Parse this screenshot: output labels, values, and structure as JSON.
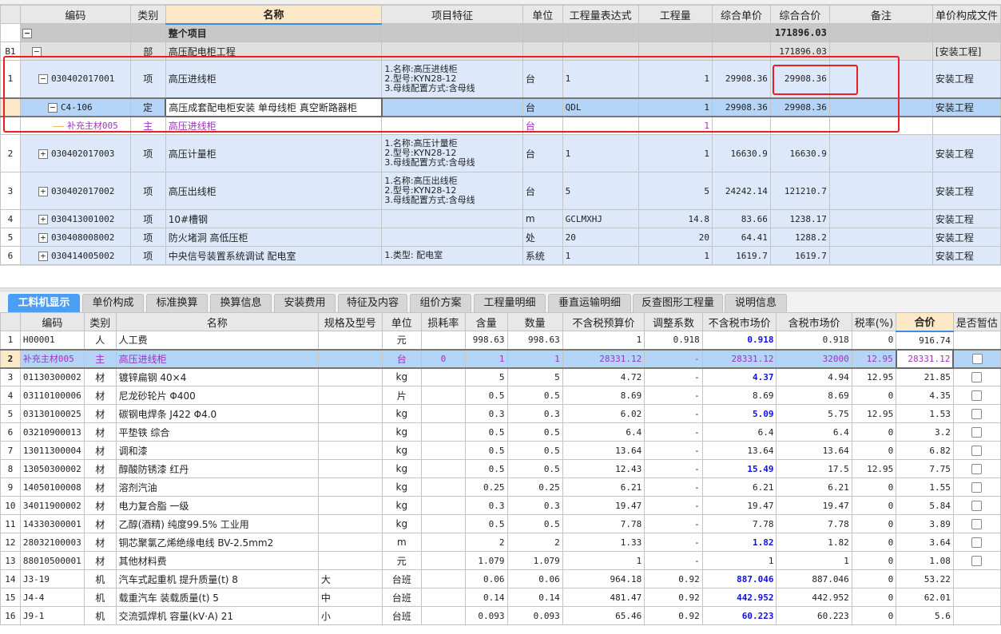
{
  "accent_color": "#4a9ff5",
  "highlight_color": "#e82020",
  "top_table": {
    "headers": [
      "",
      "编码",
      "类别",
      "名称",
      "项目特征",
      "单位",
      "工程量表达式",
      "工程量",
      "综合单价",
      "综合合价",
      "备注",
      "单价构成文件"
    ],
    "rows": [
      {
        "style": "total",
        "rn": "",
        "expand": "minus",
        "code": "",
        "type": "",
        "name": "整个项目",
        "feature": "",
        "unit": "",
        "expr": "",
        "qty": "",
        "price": "",
        "total": "171896.03",
        "note": "",
        "file": ""
      },
      {
        "style": "part",
        "rn": "B1",
        "expand": "minus",
        "code": "",
        "type": "部",
        "name": "高压配电柜工程",
        "feature": "",
        "unit": "",
        "expr": "",
        "qty": "",
        "price": "",
        "total": "171896.03",
        "note": "",
        "file": "[安装工程]"
      },
      {
        "style": "item",
        "rn": "1",
        "expand": "minus",
        "code": "030402017001",
        "type": "项",
        "name": "高压进线柜",
        "feature": "1.名称:高压进线柜\n2.型号:KYN28-12\n3.母线配置方式:含母线",
        "unit": "台",
        "expr": "1",
        "qty": "1",
        "price": "29908.36",
        "total": "29908.36",
        "note": "",
        "file": "安装工程"
      },
      {
        "style": "sel",
        "rn": "",
        "expand": "minus",
        "code": "C4-106",
        "type": "定",
        "name": "高压成套配电柜安装 单母线柜 真空断路器柜",
        "feature": "",
        "unit": "台",
        "expr": "QDL",
        "qty": "1",
        "price": "29908.36",
        "total": "29908.36",
        "note": "",
        "file": "安装工程"
      },
      {
        "style": "main",
        "rn": "",
        "expand": "",
        "code": "补充主材005",
        "type": "主",
        "name": "高压进线柜",
        "feature": "",
        "unit": "台",
        "expr": "",
        "qty": "1",
        "price": "",
        "total": "",
        "note": "",
        "file": ""
      },
      {
        "style": "item",
        "rn": "2",
        "expand": "plus",
        "code": "030402017003",
        "type": "项",
        "name": "高压计量柜",
        "feature": "1.名称:高压计量柜\n2.型号:KYN28-12\n3.母线配置方式:含母线",
        "unit": "台",
        "expr": "1",
        "qty": "1",
        "price": "16630.9",
        "total": "16630.9",
        "note": "",
        "file": "安装工程"
      },
      {
        "style": "item",
        "rn": "3",
        "expand": "plus",
        "code": "030402017002",
        "type": "项",
        "name": "高压出线柜",
        "feature": "1.名称:高压出线柜\n2.型号:KYN28-12\n3.母线配置方式:含母线",
        "unit": "台",
        "expr": "5",
        "qty": "5",
        "price": "24242.14",
        "total": "121210.7",
        "note": "",
        "file": "安装工程"
      },
      {
        "style": "item",
        "rn": "4",
        "expand": "plus",
        "code": "030413001002",
        "type": "项",
        "name": "10#槽钢",
        "feature": "",
        "unit": "m",
        "expr": "GCLMXHJ",
        "qty": "14.8",
        "price": "83.66",
        "total": "1238.17",
        "note": "",
        "file": "安装工程"
      },
      {
        "style": "item",
        "rn": "5",
        "expand": "plus",
        "code": "030408008002",
        "type": "项",
        "name": "防火堵洞 高低压柜",
        "feature": "",
        "unit": "处",
        "expr": "20",
        "qty": "20",
        "price": "64.41",
        "total": "1288.2",
        "note": "",
        "file": "安装工程"
      },
      {
        "style": "item",
        "rn": "6",
        "expand": "plus",
        "code": "030414005002",
        "type": "项",
        "name": "中央信号装置系统调试 配电室",
        "feature": "1.类型: 配电室",
        "unit": "系统",
        "expr": "1",
        "qty": "1",
        "price": "1619.7",
        "total": "1619.7",
        "note": "",
        "file": "安装工程"
      }
    ]
  },
  "tabs": [
    "工料机显示",
    "单价构成",
    "标准换算",
    "换算信息",
    "安装费用",
    "特征及内容",
    "组价方案",
    "工程量明细",
    "垂直运输明细",
    "反查图形工程量",
    "说明信息"
  ],
  "active_tab": "工料机显示",
  "bottom_table": {
    "headers": [
      "",
      "编码",
      "类别",
      "名称",
      "规格及型号",
      "单位",
      "损耗率",
      "含量",
      "数量",
      "不含税预算价",
      "调整系数",
      "不含税市场价",
      "含税市场价",
      "税率(%)",
      "合价",
      "是否暂估"
    ],
    "rows": [
      {
        "rn": "1",
        "code": "H00001",
        "type": "人",
        "name": "人工费",
        "spec": "",
        "unit": "元",
        "loss": "",
        "content": "998.63",
        "qty": "998.63",
        "budget": "1",
        "adj": "0.918",
        "mkt": "0.918",
        "mkt_tax": "0.918",
        "tax": "0",
        "sum": "916.74",
        "est": null,
        "mkt_blue": true
      },
      {
        "rn": "2",
        "code": "补充主材005",
        "type": "主",
        "name": "高压进线柜",
        "spec": "",
        "unit": "台",
        "loss": "0",
        "content": "1",
        "qty": "1",
        "budget": "28331.12",
        "adj": "-",
        "mkt": "28331.12",
        "mkt_tax": "32000",
        "tax": "12.95",
        "sum": "28331.12",
        "est": false,
        "mkt_blue": false,
        "selected": true
      },
      {
        "rn": "3",
        "code": "01130300002",
        "type": "材",
        "name": "镀锌扁钢 40×4",
        "spec": "",
        "unit": "kg",
        "loss": "",
        "content": "5",
        "qty": "5",
        "budget": "4.72",
        "adj": "-",
        "mkt": "4.37",
        "mkt_tax": "4.94",
        "tax": "12.95",
        "sum": "21.85",
        "est": false,
        "mkt_blue": true
      },
      {
        "rn": "4",
        "code": "03110100006",
        "type": "材",
        "name": "尼龙砂轮片 Φ400",
        "spec": "",
        "unit": "片",
        "loss": "",
        "content": "0.5",
        "qty": "0.5",
        "budget": "8.69",
        "adj": "-",
        "mkt": "8.69",
        "mkt_tax": "8.69",
        "tax": "0",
        "sum": "4.35",
        "est": false,
        "mkt_blue": false
      },
      {
        "rn": "5",
        "code": "03130100025",
        "type": "材",
        "name": "碳钢电焊条 J422 Φ4.0",
        "spec": "",
        "unit": "kg",
        "loss": "",
        "content": "0.3",
        "qty": "0.3",
        "budget": "6.02",
        "adj": "-",
        "mkt": "5.09",
        "mkt_tax": "5.75",
        "tax": "12.95",
        "sum": "1.53",
        "est": false,
        "mkt_blue": true
      },
      {
        "rn": "6",
        "code": "03210900013",
        "type": "材",
        "name": "平垫铁 综合",
        "spec": "",
        "unit": "kg",
        "loss": "",
        "content": "0.5",
        "qty": "0.5",
        "budget": "6.4",
        "adj": "-",
        "mkt": "6.4",
        "mkt_tax": "6.4",
        "tax": "0",
        "sum": "3.2",
        "est": false,
        "mkt_blue": false
      },
      {
        "rn": "7",
        "code": "13011300004",
        "type": "材",
        "name": "调和漆",
        "spec": "",
        "unit": "kg",
        "loss": "",
        "content": "0.5",
        "qty": "0.5",
        "budget": "13.64",
        "adj": "-",
        "mkt": "13.64",
        "mkt_tax": "13.64",
        "tax": "0",
        "sum": "6.82",
        "est": false,
        "mkt_blue": false
      },
      {
        "rn": "8",
        "code": "13050300002",
        "type": "材",
        "name": "醇酸防锈漆 红丹",
        "spec": "",
        "unit": "kg",
        "loss": "",
        "content": "0.5",
        "qty": "0.5",
        "budget": "12.43",
        "adj": "-",
        "mkt": "15.49",
        "mkt_tax": "17.5",
        "tax": "12.95",
        "sum": "7.75",
        "est": false,
        "mkt_blue": true
      },
      {
        "rn": "9",
        "code": "14050100008",
        "type": "材",
        "name": "溶剂汽油",
        "spec": "",
        "unit": "kg",
        "loss": "",
        "content": "0.25",
        "qty": "0.25",
        "budget": "6.21",
        "adj": "-",
        "mkt": "6.21",
        "mkt_tax": "6.21",
        "tax": "0",
        "sum": "1.55",
        "est": false,
        "mkt_blue": false
      },
      {
        "rn": "10",
        "code": "34011900002",
        "type": "材",
        "name": "电力复合脂 一级",
        "spec": "",
        "unit": "kg",
        "loss": "",
        "content": "0.3",
        "qty": "0.3",
        "budget": "19.47",
        "adj": "-",
        "mkt": "19.47",
        "mkt_tax": "19.47",
        "tax": "0",
        "sum": "5.84",
        "est": false,
        "mkt_blue": false
      },
      {
        "rn": "11",
        "code": "14330300001",
        "type": "材",
        "name": "乙醇(酒精) 纯度99.5% 工业用",
        "spec": "",
        "unit": "kg",
        "loss": "",
        "content": "0.5",
        "qty": "0.5",
        "budget": "7.78",
        "adj": "-",
        "mkt": "7.78",
        "mkt_tax": "7.78",
        "tax": "0",
        "sum": "3.89",
        "est": false,
        "mkt_blue": false
      },
      {
        "rn": "12",
        "code": "28032100003",
        "type": "材",
        "name": "铜芯聚氯乙烯绝缘电线 BV-2.5mm2",
        "spec": "",
        "unit": "m",
        "loss": "",
        "content": "2",
        "qty": "2",
        "budget": "1.33",
        "adj": "-",
        "mkt": "1.82",
        "mkt_tax": "1.82",
        "tax": "0",
        "sum": "3.64",
        "est": false,
        "mkt_blue": true
      },
      {
        "rn": "13",
        "code": "88010500001",
        "type": "材",
        "name": "其他材料费",
        "spec": "",
        "unit": "元",
        "loss": "",
        "content": "1.079",
        "qty": "1.079",
        "budget": "1",
        "adj": "-",
        "mkt": "1",
        "mkt_tax": "1",
        "tax": "0",
        "sum": "1.08",
        "est": false,
        "mkt_blue": false
      },
      {
        "rn": "14",
        "code": "J3-19",
        "type": "机",
        "name": "汽车式起重机 提升质量(t) 8",
        "spec": "大",
        "unit": "台班",
        "loss": "",
        "content": "0.06",
        "qty": "0.06",
        "budget": "964.18",
        "adj": "0.92",
        "mkt": "887.046",
        "mkt_tax": "887.046",
        "tax": "0",
        "sum": "53.22",
        "est": null,
        "mkt_blue": true
      },
      {
        "rn": "15",
        "code": "J4-4",
        "type": "机",
        "name": "载重汽车 装载质量(t) 5",
        "spec": "中",
        "unit": "台班",
        "loss": "",
        "content": "0.14",
        "qty": "0.14",
        "budget": "481.47",
        "adj": "0.92",
        "mkt": "442.952",
        "mkt_tax": "442.952",
        "tax": "0",
        "sum": "62.01",
        "est": null,
        "mkt_blue": true
      },
      {
        "rn": "16",
        "code": "J9-1",
        "type": "机",
        "name": "交流弧焊机 容量(kV·A) 21",
        "spec": "小",
        "unit": "台班",
        "loss": "",
        "content": "0.093",
        "qty": "0.093",
        "budget": "65.46",
        "adj": "0.92",
        "mkt": "60.223",
        "mkt_tax": "60.223",
        "tax": "0",
        "sum": "5.6",
        "est": null,
        "mkt_blue": true
      }
    ]
  }
}
